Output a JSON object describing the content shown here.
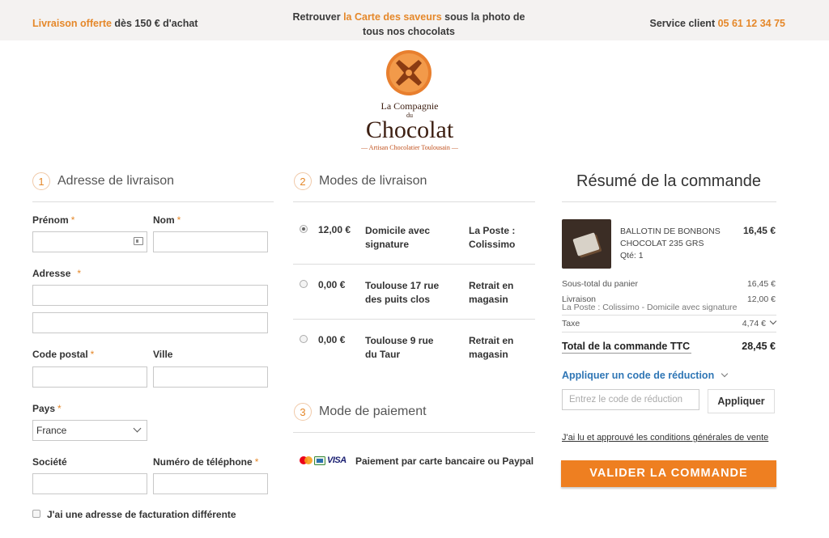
{
  "topbar": {
    "free_delivery_em": "Livraison offerte",
    "free_delivery_rest": " dès 150 € d'achat",
    "mid_pre": "Retrouver ",
    "mid_em": "la Carte des saveurs",
    "mid_post": " sous la photo de tous nos chocolats",
    "service_label": "Service client ",
    "service_phone": "05 61 12 34 75"
  },
  "logo": {
    "line1": "La Compagnie",
    "line2": "du",
    "line3": "Chocolat",
    "tagline": "— Artisan Chocolatier Toulousain —"
  },
  "address": {
    "step": "1",
    "title": "Adresse de livraison",
    "prenom": "Prénom",
    "nom": "Nom",
    "adresse": "Adresse",
    "code_postal": "Code postal",
    "ville": "Ville",
    "pays": "Pays",
    "pays_value": "France",
    "societe": "Société",
    "telephone": "Numéro de téléphone",
    "required_mark": "*",
    "billing_checkbox": "J'ai une adresse de facturation différente"
  },
  "shipping": {
    "step": "2",
    "title": "Modes de livraison",
    "options": [
      {
        "price": "12,00 €",
        "name": "Domicile avec signature",
        "carrier": "La Poste : Colissimo",
        "selected": true
      },
      {
        "price": "0,00 €",
        "name": "Toulouse 17 rue des puits clos",
        "carrier": "Retrait en magasin",
        "selected": false
      },
      {
        "price": "0,00 €",
        "name": "Toulouse 9 rue du Taur",
        "carrier": "Retrait en magasin",
        "selected": false
      }
    ]
  },
  "payment": {
    "step": "3",
    "title": "Mode de paiement",
    "visa_text": "VISA",
    "method_label": "Paiement par carte bancaire ou Paypal"
  },
  "summary": {
    "title": "Résumé de la commande",
    "product": {
      "name_line1": "BALLOTIN DE BONBONS",
      "name_line2": "CHOCOLAT 235 GRS",
      "qty": "Qté: 1",
      "price": "16,45 €"
    },
    "subtotal_label": "Sous-total du panier",
    "subtotal_value": "16,45 €",
    "delivery_label": "Livraison",
    "delivery_detail": "La Poste : Colissimo - Domicile avec signature",
    "delivery_value": "12,00 €",
    "tax_label": "Taxe",
    "tax_value": "4,74 €",
    "total_label": "Total de la commande TTC",
    "total_value": "28,45 €",
    "promo_link": "Appliquer un code de réduction",
    "promo_placeholder": "Entrez le code de réduction",
    "apply_label": "Appliquer",
    "cgv_label": "J'ai lu et approuvé les conditions générales de vente",
    "validate_label": "VALIDER LA COMMANDE"
  },
  "colors": {
    "accent": "#ee7f21",
    "link": "#2f76b5",
    "topbar_bg": "#f4f2f1",
    "chocolate": "#3d1f12"
  }
}
